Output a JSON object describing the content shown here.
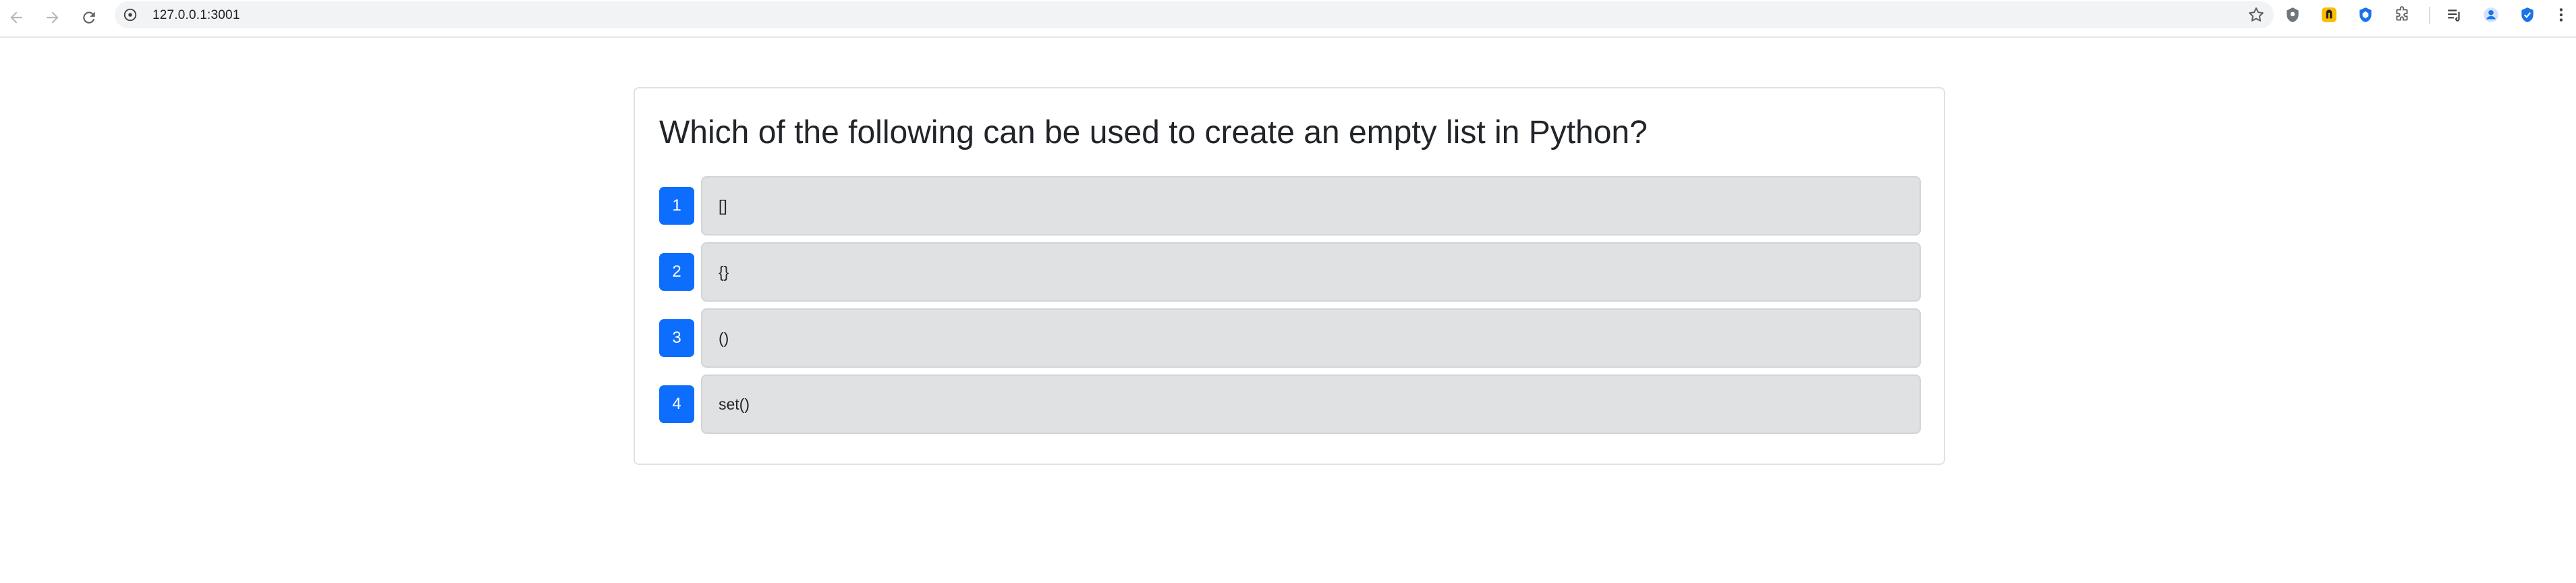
{
  "browser": {
    "url": "127.0.0.1:3001",
    "icons": {
      "back": "arrow-left-icon",
      "forward": "arrow-right-icon",
      "reload": "reload-icon",
      "site_info": "site-info-icon",
      "bookmark": "star-icon"
    },
    "extensions": [
      "extension-gray-badge-icon",
      "extension-yellow-badge-icon",
      "extension-blue-shield-icon",
      "extensions-puzzle-icon",
      "reading-list-icon",
      "profile-icon",
      "blue-check-shield-icon",
      "more-menu-icon"
    ]
  },
  "quiz": {
    "question": "Which of the following can be used to create an empty list in Python?",
    "options": [
      {
        "number": "1",
        "text": "[]"
      },
      {
        "number": "2",
        "text": "{}"
      },
      {
        "number": "3",
        "text": "()"
      },
      {
        "number": "4",
        "text": "set()"
      }
    ]
  },
  "colors": {
    "accent": "#0d6efd",
    "option_background": "#e0e1e3",
    "text": "#212529"
  }
}
